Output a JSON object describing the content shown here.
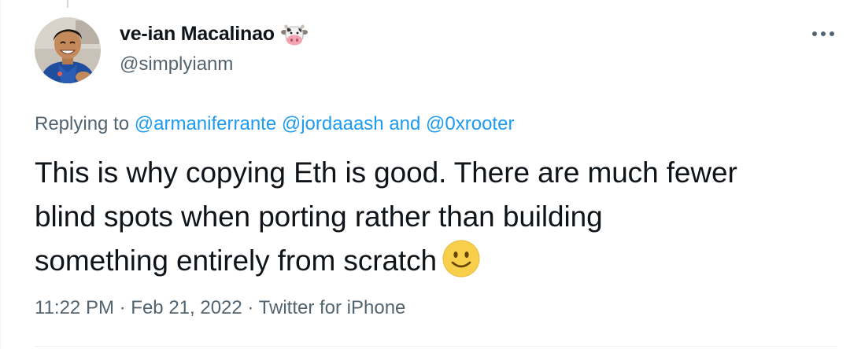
{
  "author": {
    "display_name": "ve-ian Macalinao",
    "handle": "@simplyianm",
    "badge_icon": "cow-face-icon"
  },
  "more_button": {
    "icon": "more-horizontal-icon",
    "glyph": "•••"
  },
  "reply_context": {
    "prefix": "Replying to",
    "mentions": [
      "@armaniferrante",
      "@jordaaash"
    ],
    "conjunction": "and",
    "last_mention": "@0xrooter"
  },
  "tweet": {
    "lines": [
      "This is why copying Eth is good. There are much fewer",
      "blind spots when porting rather than building",
      "something entirely from scratch"
    ],
    "emoji": "slightly-smiling-face-icon"
  },
  "meta": {
    "time": "11:22 PM",
    "separator": "·",
    "date": "Feb 21, 2022",
    "source": "Twitter for iPhone"
  },
  "colors": {
    "text": "#0f1419",
    "secondary": "#536471",
    "link": "#1d9bf0",
    "border": "#eff3f4"
  }
}
